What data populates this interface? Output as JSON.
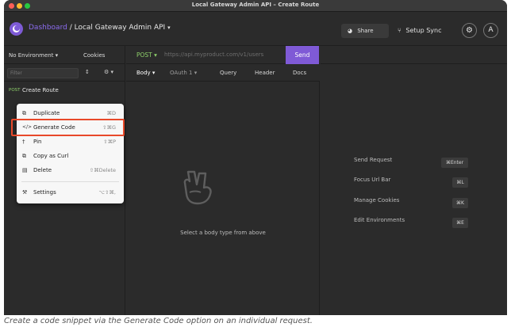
{
  "window": {
    "title": "Local Gateway Admin API – Create Route"
  },
  "header": {
    "dashboard_label": "Dashboard",
    "separator": " / ",
    "workspace_label": "Local Gateway Admin API",
    "workspace_caret": "▾",
    "share_label": "Share",
    "share_icon": "◕",
    "setup_sync_icon": "⑂",
    "setup_sync_label": "Setup Sync",
    "settings_icon": "⚙",
    "account_icon": "A"
  },
  "sidebar": {
    "environment_label": "No Environment ▾",
    "cookies_label": "Cookies",
    "filter_placeholder": "Filter",
    "sort_icon": "↕",
    "more_icon": "⚙ ▾",
    "request": {
      "method": "POST",
      "name": "Create Route"
    }
  },
  "context_menu": {
    "items": [
      {
        "icon": "⧉",
        "label": "Duplicate",
        "shortcut": "⌘D"
      },
      {
        "icon": "</>",
        "label": "Generate Code",
        "shortcut": "⇧⌘G"
      },
      {
        "icon": "†",
        "label": "Pin",
        "shortcut": "⇧⌘P"
      },
      {
        "icon": "⧉",
        "label": "Copy as Curl",
        "shortcut": ""
      },
      {
        "icon": "▤",
        "label": "Delete",
        "shortcut": "⇧⌘Delete"
      },
      {
        "icon": "⚒",
        "label": "Settings",
        "shortcut": "⌥⇧⌘,"
      }
    ]
  },
  "request_bar": {
    "method": "POST ▾",
    "url_placeholder": "https://api.myproduct.com/v1/users",
    "send_label": "Send"
  },
  "tabs": [
    {
      "label": "Body ▾"
    },
    {
      "label": "OAuth 1 ▾"
    },
    {
      "label": "Query"
    },
    {
      "label": "Header"
    },
    {
      "label": "Docs"
    }
  ],
  "body": {
    "empty_text": "Select a body type from above"
  },
  "shortcuts": [
    {
      "label": "Send Request",
      "key": "⌘Enter"
    },
    {
      "label": "Focus Url Bar",
      "key": "⌘L"
    },
    {
      "label": "Manage Cookies",
      "key": "⌘K"
    },
    {
      "label": "Edit Environments",
      "key": "⌘E"
    }
  ],
  "caption": "Create a code snippet via the Generate Code option on an individual request.",
  "colors": {
    "accent": "#7f5ad6",
    "highlight": "#e8492a",
    "post": "#8fd16b"
  }
}
